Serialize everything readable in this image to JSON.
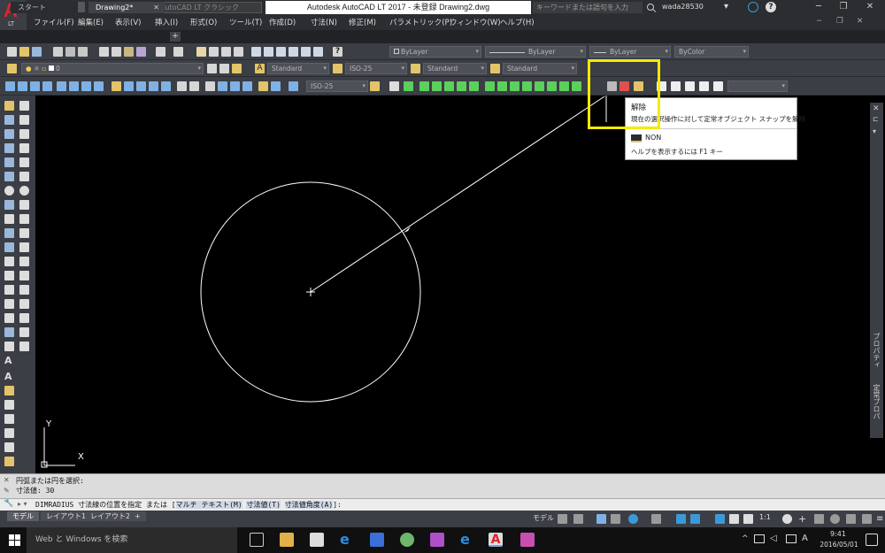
{
  "window": {
    "title": "Autodesk AutoCAD LT 2017 - 未登録    Drawing2.dwg",
    "workspace": "AutoCAD LT クラシック",
    "search_placeholder": "キーワードまたは語句を入力",
    "user": "wada28530"
  },
  "menu": [
    "ファイル(F)",
    "編集(E)",
    "表示(V)",
    "挿入(I)",
    "形式(O)",
    "ツール(T)",
    "作成(D)",
    "寸法(N)",
    "修正(M)",
    "パラメトリック(P)",
    "ウィンドウ(W)",
    "ヘルプ(H)"
  ],
  "tabs": {
    "start": "スタート",
    "drawing": "Drawing2*"
  },
  "properties": {
    "color": "ByLayer",
    "linetype": "ByLayer",
    "lineweight": "ByLayer",
    "plotstyle": "ByColor"
  },
  "layer": {
    "name": "0"
  },
  "styles": {
    "text_style": "Standard",
    "dim_style": "ISO-25",
    "table_style": "Standard",
    "mleader_style": "Standard",
    "dim_style_2": "ISO-25"
  },
  "tooltip": {
    "title": "解除",
    "description": "現在の選択操作に対して定常オブジェクト スナップを解除",
    "command": "NON",
    "help": "ヘルプを表示するには F1 キー"
  },
  "right_palette": {
    "label": "プロパティ",
    "label2": "定常プロパ"
  },
  "ucs": {
    "x": "X",
    "y": "Y"
  },
  "command": {
    "history": [
      "円弧または円を選択:",
      "寸法値: 30"
    ],
    "prompt_prefix": "DIMRADIUS 寸法線の位置を指定 または [",
    "option1": "マルチ テキスト(M)",
    "option2": "寸法値(T)",
    "option3": "寸法値角度(A)",
    "prompt_suffix": "]:"
  },
  "layout_tabs": [
    "モデル",
    "レイアウト1",
    "レイアウト2"
  ],
  "status": {
    "model": "モデル",
    "scale": "1:1"
  },
  "taskbar": {
    "search": "Web と Windows を検索",
    "ime": "A",
    "time": "9:41",
    "date": "2016/05/01"
  },
  "colors": {
    "highlight": "#f5ea00",
    "brand": "#e0232b"
  }
}
